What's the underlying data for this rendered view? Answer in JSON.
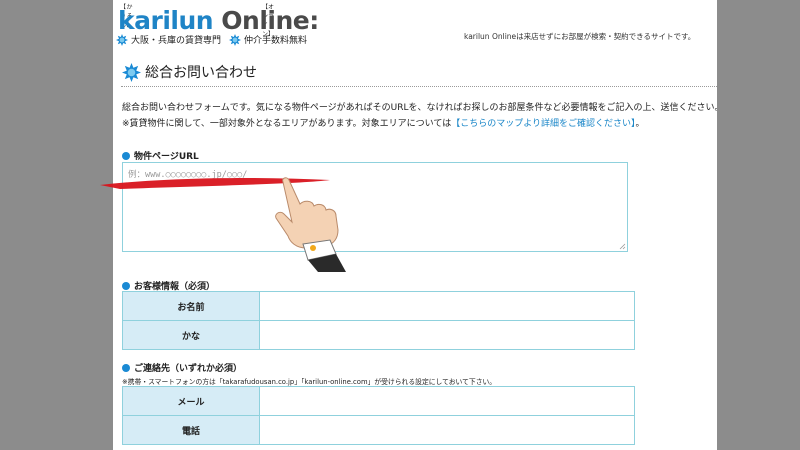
{
  "header": {
    "logo_kana": "【かりるん】",
    "logo_kana2": "【オンライン】",
    "logo_brand": "karilun",
    "logo_suffix": "Online:",
    "tagline": "karilun Onlineは来店せずにお部屋が検索・契約できるサイトです。",
    "features": [
      "大阪・兵庫の賃貸専門",
      "仲介手数料無料"
    ]
  },
  "page": {
    "title": "総合お問い合わせ",
    "intro_line1": "総合お問い合わせフォームです。気になる物件ページがあればそのURLを、なければお探しのお部屋条件など必要情報をご記入の上、送信ください。",
    "intro_line2_prefix": "※賃貸物件に関して、一部対象外となるエリアがあります。対象エリアについては",
    "intro_link": "【こちらのマップより詳細をご確認ください】",
    "intro_line2_suffix": "。"
  },
  "sections": {
    "property_url": {
      "heading": "物件ページURL",
      "placeholder": "例：www.○○○○○○○○.jp/○○○/"
    },
    "customer_info": {
      "heading": "お客様情報（必須）",
      "fields": [
        "お名前",
        "かな"
      ]
    },
    "contact": {
      "heading": "ご連絡先（いずれか必須）",
      "note": "※携帯・スマートフォンの方は「takarafudousan.co.jp」「karilun-online.com」が受けられる設定にしておいて下さい。",
      "fields": [
        "メール",
        "電話"
      ]
    }
  },
  "colors": {
    "brand_blue": "#1f84c6",
    "accent_cyan": "#1a8ad4",
    "label_bg": "#d6ecf6",
    "border": "#8fd1dd",
    "annotation_red": "#d8141c"
  },
  "icons": {
    "burst": "starburst-icon",
    "pointer": "pointing-hand-icon"
  }
}
